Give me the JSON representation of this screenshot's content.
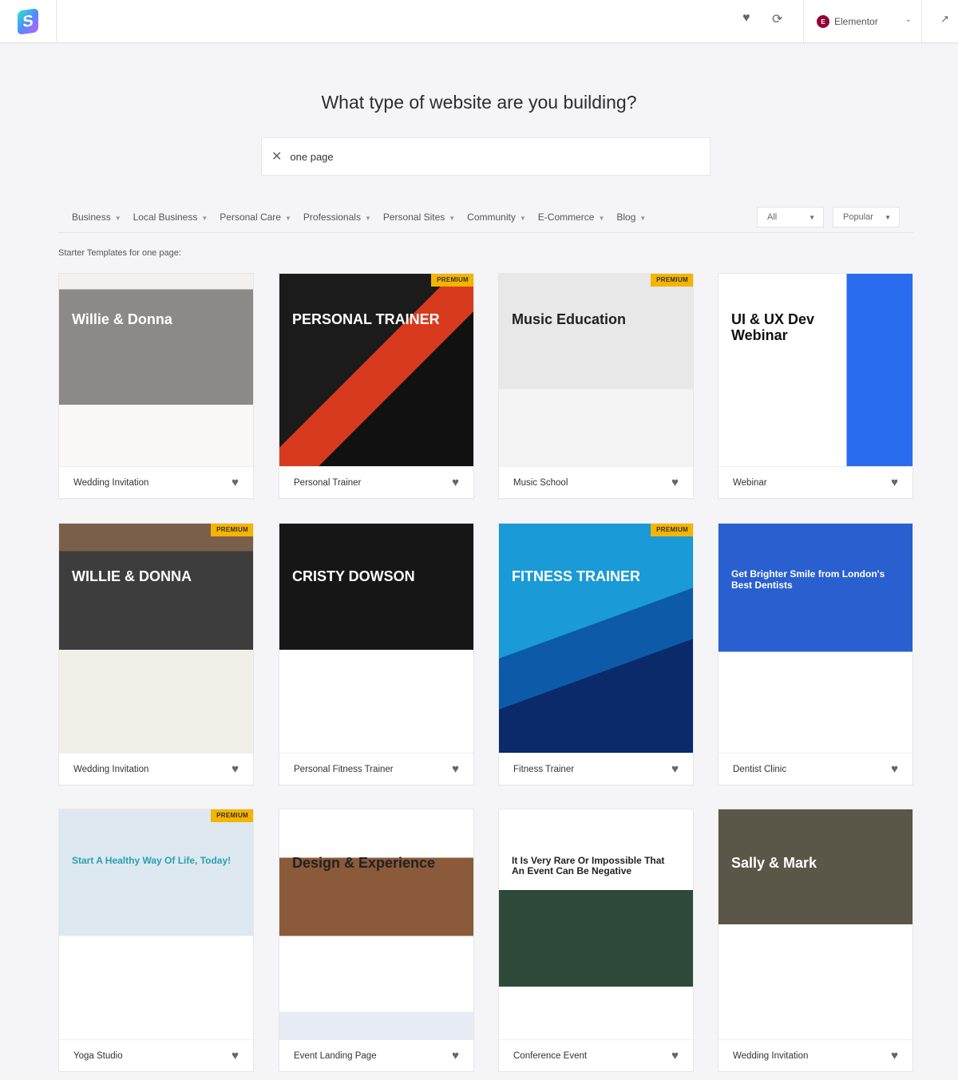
{
  "header": {
    "builder": "Elementor",
    "builder_badge": "E",
    "icons": [
      "heart-icon",
      "sync-icon",
      "chevron-down-icon",
      "external-link-icon"
    ]
  },
  "main": {
    "title": "What type of website are you building?",
    "search_value": "one page",
    "categories": [
      "Business",
      "Local Business",
      "Personal Care",
      "Professionals",
      "Personal Sites",
      "Community",
      "E-Commerce",
      "Blog"
    ],
    "filter_type": "All",
    "sort": "Popular",
    "subtitle": "Starter Templates for one page:"
  },
  "premium_label": "PREMIUM",
  "templates": [
    {
      "name": "Wedding Invitation",
      "premium": false,
      "headline": "Willie & Donna",
      "bg": "linear-gradient(#f4f0ee 0 8%,#8b8a88 8% 68%,#faf8f6 68%)",
      "fg": "#fff"
    },
    {
      "name": "Personal Trainer",
      "premium": true,
      "headline": "PERSONAL TRAINER",
      "bg": "linear-gradient(135deg,#1b1b1b 0 45%,#d83a1e 45% 60%,#111 60%)",
      "fg": "#fff"
    },
    {
      "name": "Music School",
      "premium": true,
      "headline": "Music Education",
      "bg": "linear-gradient(#e8e8e8 0 60%,#f4f4f4 60%)",
      "fg": "#222"
    },
    {
      "name": "Webinar",
      "premium": false,
      "headline": "UI & UX Dev Webinar",
      "bg": "linear-gradient(90deg,#fff 0 66%,#2a6cf0 66%)",
      "fg": "#111"
    },
    {
      "name": "Wedding Invitation",
      "premium": true,
      "headline": "WILLIE & DONNA",
      "bg": "linear-gradient(#7a5f4a 0 12%,#3d3d3d 12% 55%,#f2eee8 55%)",
      "fg": "#fff"
    },
    {
      "name": "Personal Fitness Trainer",
      "premium": false,
      "headline": "CRISTY DOWSON",
      "bg": "linear-gradient(#161616 0 55%,#fff 55%)",
      "fg": "#fff"
    },
    {
      "name": "Fitness Trainer",
      "premium": true,
      "headline": "FITNESS TRAINER",
      "bg": "linear-gradient(160deg,#1a9ad6 0 45%,#0c5aa8 45% 62%,#0a2a6a 62%)",
      "fg": "#fff"
    },
    {
      "name": "Dentist Clinic",
      "premium": false,
      "headline": "Get Brighter Smile from London's Best Dentists",
      "bg": "linear-gradient(#2a5fd0 0 56%,#fff 56%)",
      "fg": "#fff"
    },
    {
      "name": "Yoga Studio",
      "premium": true,
      "headline": "Start A Healthy Way Of Life, Today!",
      "bg": "linear-gradient(#dde8f0 0 55%,#fff 55%)",
      "fg": "#2aa0b0"
    },
    {
      "name": "Event Landing Page",
      "premium": false,
      "headline": "Design & Experience",
      "bg": "linear-gradient(#fff 0 21%,#8a5a3a 21% 55%,#fff 55% 88%,#e8ecf5 88%)",
      "fg": "#222"
    },
    {
      "name": "Conference Event",
      "premium": false,
      "headline": "It Is Very Rare Or Impossible That An Event Can Be Negative",
      "bg": "linear-gradient(#fff 0 35%,#2e4a3a 35% 77%,#fff 77%)",
      "fg": "#222"
    },
    {
      "name": "Wedding Invitation",
      "premium": false,
      "headline": "Sally & Mark",
      "bg": "linear-gradient(#5a5648 0 50%,#fff 50%)",
      "fg": "#fff"
    }
  ]
}
